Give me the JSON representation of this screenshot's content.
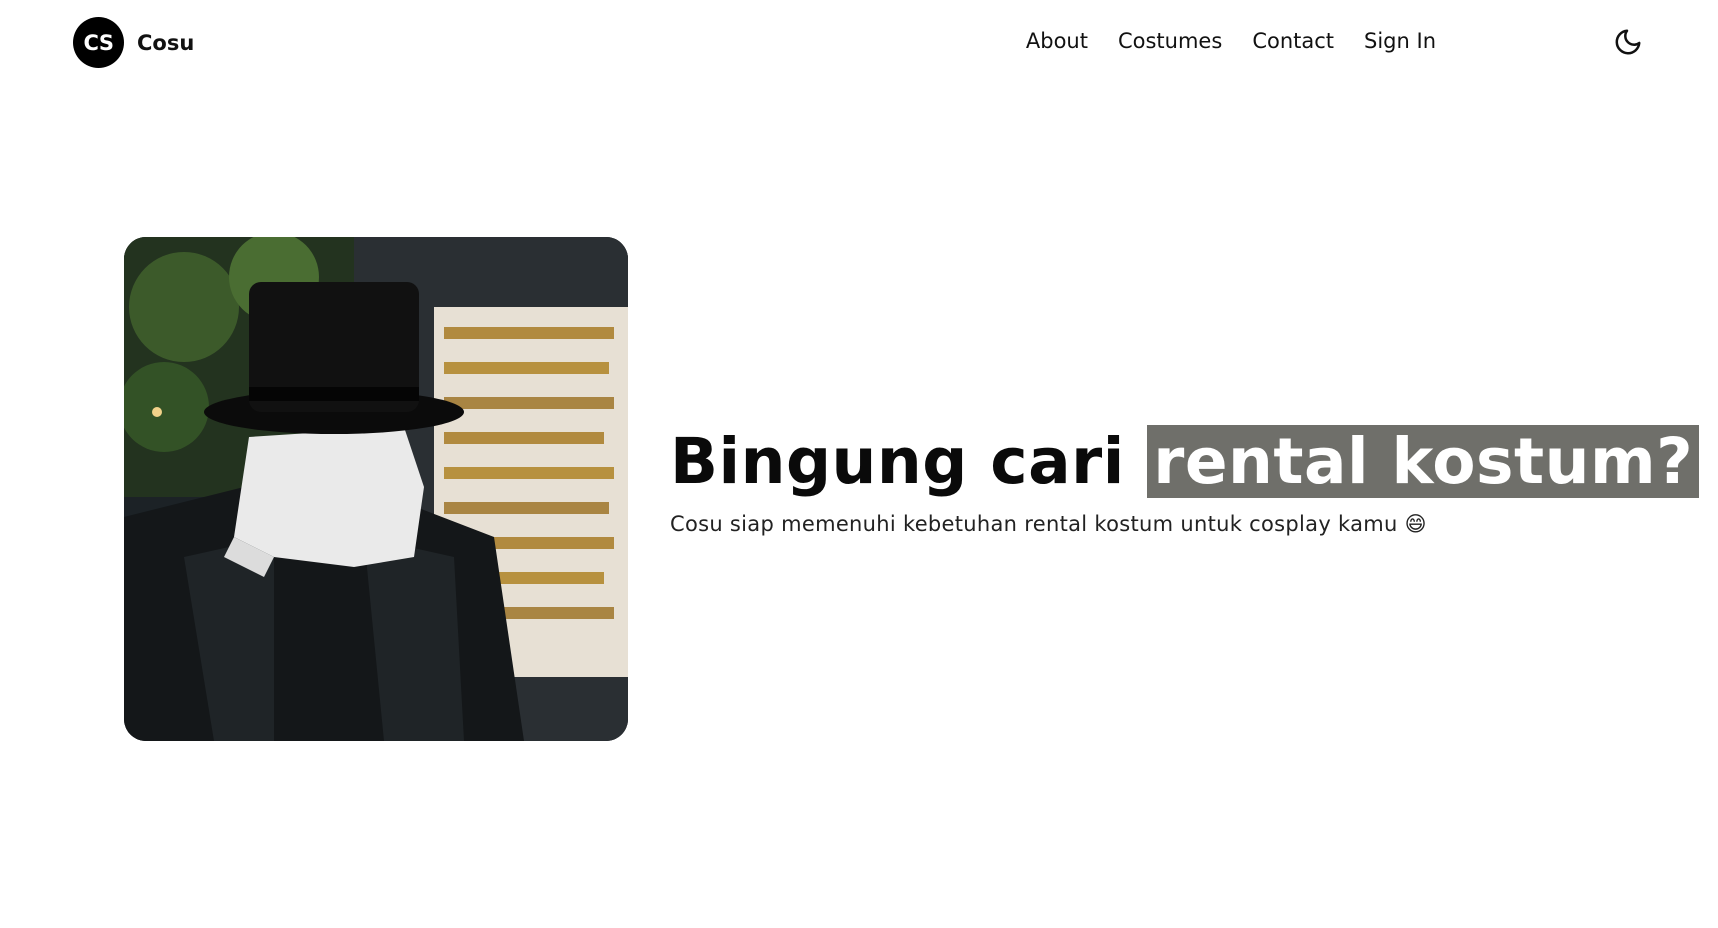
{
  "brand": {
    "logo_text": "CS",
    "name": "Cosu"
  },
  "nav": {
    "items": [
      {
        "label": "About"
      },
      {
        "label": "Costumes"
      },
      {
        "label": "Contact"
      },
      {
        "label": "Sign In"
      }
    ],
    "theme_icon": "moon-icon"
  },
  "hero": {
    "headline_plain": "Bingung cari ",
    "headline_highlight": "rental kostum?",
    "subtitle": "Cosu siap memenuhi kebetuhan rental kostum untuk cosplay kamu 😄"
  },
  "colors": {
    "highlight_bg": "#6f6f6a",
    "logo_bg": "#000000"
  }
}
